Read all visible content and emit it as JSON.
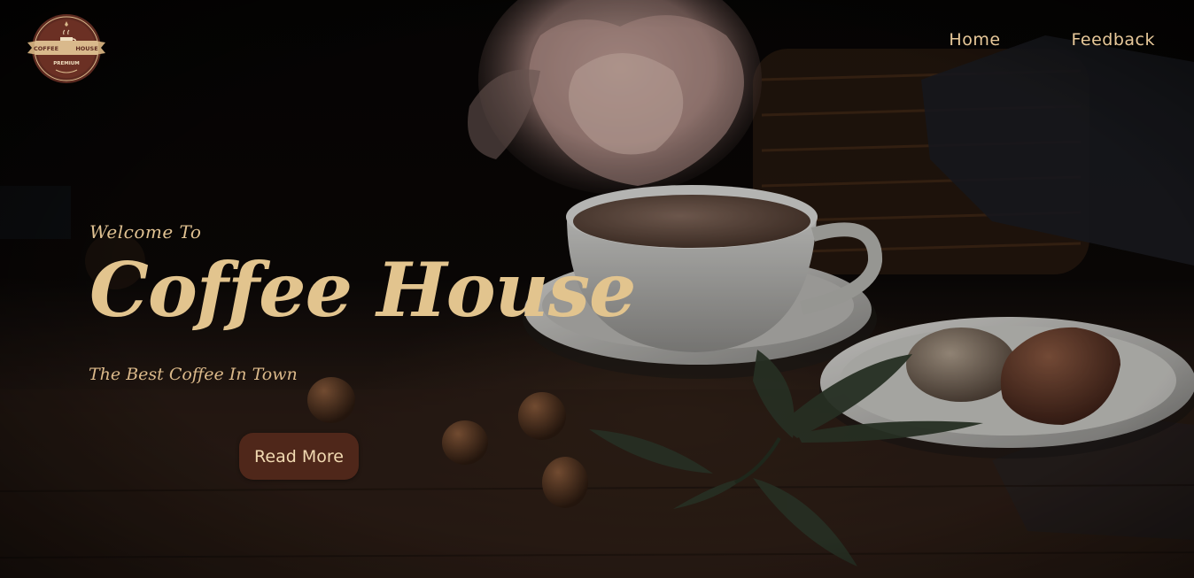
{
  "logo": {
    "left_text": "COFFEE",
    "right_text": "HOUSE",
    "bottom_text": "PREMIUM",
    "ring_color": "#5d2a20",
    "ribbon_color": "#d9b98c",
    "icon": "coffee-cup-icon"
  },
  "nav": {
    "items": [
      {
        "label": "Home"
      },
      {
        "label": "Feedback"
      }
    ],
    "text_color": "#e8c99a"
  },
  "hero": {
    "welcome": "Welcome To",
    "title": "Coffee House",
    "tagline": "The Best Coffee In Town",
    "button_label": "Read More",
    "accent_color": "#e2c48e",
    "button_color": "#4f271a"
  }
}
